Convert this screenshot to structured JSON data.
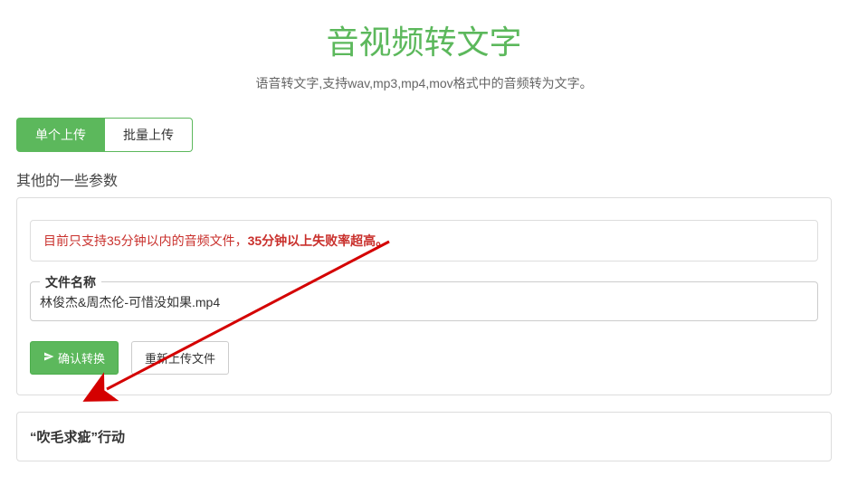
{
  "header": {
    "title": "音视频转文字",
    "subtitle": "语音转文字,支持wav,mp3,mp4,mov格式中的音频转为文字。"
  },
  "tabs": {
    "single": "单个上传",
    "batch": "批量上传"
  },
  "section_label": "其他的一些参数",
  "warning": {
    "prefix": "目前只支持35分钟以内的音频文件，",
    "emphasis": "35分钟以上失败率超高。"
  },
  "file_field": {
    "legend": "文件名称",
    "name": "林俊杰&周杰伦-可惜没如果.mp4"
  },
  "buttons": {
    "confirm": "确认转换",
    "reupload": "重新上传文件"
  },
  "second_section": {
    "title": "“吹毛求疵”行动"
  }
}
